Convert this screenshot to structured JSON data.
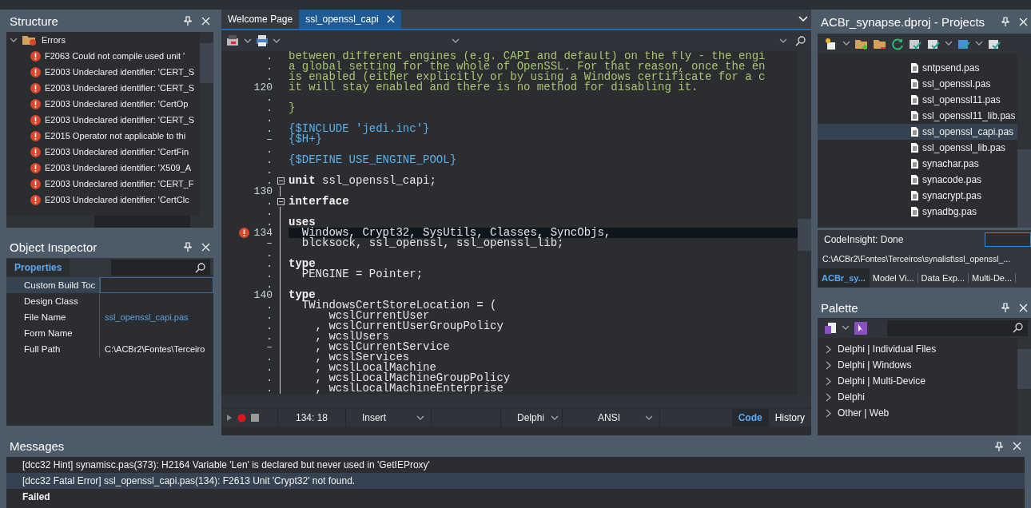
{
  "structure": {
    "title": "Structure",
    "root": {
      "label": "Errors",
      "expanded": true,
      "children": [
        {
          "label": "F2063 Could not compile used unit '"
        },
        {
          "label": "E2003 Undeclared identifier: 'CERT_S"
        },
        {
          "label": "E2003 Undeclared identifier: 'CERT_S"
        },
        {
          "label": "E2003 Undeclared identifier: 'CertOp"
        },
        {
          "label": "E2003 Undeclared identifier: 'CERT_S"
        },
        {
          "label": "E2015 Operator not applicable to thi"
        },
        {
          "label": "E2003 Undeclared identifier: 'CertFin"
        },
        {
          "label": "E2003 Undeclared identifier: 'X509_A"
        },
        {
          "label": "E2003 Undeclared identifier: 'CERT_F"
        },
        {
          "label": "E2003 Undeclared identifier: 'CertClc"
        }
      ]
    }
  },
  "object_inspector": {
    "title": "Object Inspector",
    "tab": "Properties",
    "properties": [
      {
        "name": "Custom Build Toc",
        "selected": true,
        "kind": "text"
      },
      {
        "name": "Design Class",
        "selected": false
      },
      {
        "name": "File Name",
        "value": "ssl_openssl_capi.pas",
        "selected": false,
        "kind": "link"
      },
      {
        "name": "Form Name",
        "selected": false
      },
      {
        "name": "Full Path",
        "value": "C:\\ACBr2\\Fontes\\Terceiro",
        "selected": false,
        "kind": "text"
      }
    ]
  },
  "editor": {
    "tabs": [
      {
        "label": "Welcome Page",
        "selected": false
      },
      {
        "label": "ssl_openssl_capi",
        "selected": true
      }
    ],
    "lines": [
      {
        "gutter": ".",
        "text": "between different engines (e.g. CAPI and default) on the fly - the engi",
        "kind": "comment",
        "error": false,
        "fold": false
      },
      {
        "gutter": ".",
        "text": "a global setting for the whole of OpenSSL. For that reason, once the en",
        "kind": "comment",
        "error": false,
        "fold": false
      },
      {
        "gutter": ".",
        "text": "is enabled (either explicitly or by using a Windows certificate for a c",
        "kind": "comment",
        "error": false,
        "fold": false
      },
      {
        "gutter": "120",
        "text": "it will stay enabled and there is no method for disabling it.",
        "kind": "comment",
        "error": false,
        "fold": false
      },
      {
        "gutter": ".",
        "error": false,
        "fold": false
      },
      {
        "gutter": ".",
        "text": "}",
        "kind": "comment",
        "error": false,
        "fold": false
      },
      {
        "gutter": ".",
        "error": false,
        "fold": false
      },
      {
        "gutter": ".",
        "text": "{$INCLUDE 'jedi.inc'}",
        "kind": "directive",
        "error": false,
        "fold": false
      },
      {
        "gutter": "–",
        "text": "{$H+}",
        "kind": "directive",
        "error": false,
        "fold": false
      },
      {
        "gutter": ".",
        "error": false,
        "fold": false
      },
      {
        "gutter": ".",
        "text": "{$DEFINE USE_ENGINE_POOL}",
        "kind": "directive",
        "error": false,
        "fold": false
      },
      {
        "gutter": ".",
        "error": false,
        "fold": false
      },
      {
        "gutter": ".",
        "text": "**unit** ssl_openssl_capi;",
        "kind": "code",
        "error": false,
        "fold": true
      },
      {
        "gutter": "130",
        "error": false,
        "fold": false
      },
      {
        "gutter": ".",
        "text": "interface",
        "kind": "keyword",
        "error": false,
        "fold": true
      },
      {
        "gutter": ".",
        "error": false,
        "fold": false
      },
      {
        "gutter": ".",
        "text": "uses",
        "kind": "keyword",
        "error": false,
        "fold": false
      },
      {
        "gutter": "134",
        "text": "  Windows, Crypt32, SysUtils, Classes, SyncObjs,",
        "kind": "code",
        "error": true,
        "fold": false
      },
      {
        "gutter": "–",
        "text": "  blcksock, ssl_openssl, ssl_openssl_lib;",
        "kind": "code",
        "error": false,
        "fold": false
      },
      {
        "gutter": ".",
        "error": false,
        "fold": false
      },
      {
        "gutter": ".",
        "text": "type",
        "kind": "keyword",
        "error": false,
        "fold": false
      },
      {
        "gutter": ".",
        "text": "  PENGINE = Pointer;",
        "kind": "code",
        "error": false,
        "fold": false
      },
      {
        "gutter": ".",
        "error": false,
        "fold": false
      },
      {
        "gutter": "140",
        "text": "type",
        "kind": "keyword",
        "error": false,
        "fold": false
      },
      {
        "gutter": ".",
        "text": "  TWindowsCertStoreLocation = (",
        "kind": "code",
        "error": false,
        "fold": false
      },
      {
        "gutter": ".",
        "text": "      wcslCurrentUser",
        "kind": "code",
        "error": false,
        "fold": false
      },
      {
        "gutter": ".",
        "text": "    , wcslCurrentUserGroupPolicy",
        "kind": "code",
        "error": false,
        "fold": false
      },
      {
        "gutter": ".",
        "text": "    , wcslUsers",
        "kind": "code",
        "error": false,
        "fold": false
      },
      {
        "gutter": "–",
        "text": "    , wcslCurrentService",
        "kind": "code",
        "error": false,
        "fold": false
      },
      {
        "gutter": ".",
        "text": "    , wcslServices",
        "kind": "code",
        "error": false,
        "fold": false
      },
      {
        "gutter": ".",
        "text": "    , wcslLocalMachine",
        "kind": "code",
        "error": false,
        "fold": false
      },
      {
        "gutter": ".",
        "text": "    , wcslLocalMachineGroupPolicy",
        "kind": "code",
        "error": false,
        "fold": false
      },
      {
        "gutter": ".",
        "text": "    , wcslLocalMachineEnterprise",
        "kind": "code",
        "error": false,
        "fold": false
      }
    ],
    "status": {
      "position": "134: 18",
      "mode": "Insert",
      "language": "Delphi",
      "encoding": "ANSI"
    },
    "view_tabs": [
      {
        "label": "Code",
        "selected": true
      },
      {
        "label": "History",
        "selected": false
      }
    ]
  },
  "projects": {
    "title": "ACBr_synapse.dproj - Projects",
    "files": [
      {
        "label": "sntpsend.pas",
        "selected": false
      },
      {
        "label": "ssl_openssl.pas",
        "selected": false
      },
      {
        "label": "ssl_openssl11.pas",
        "selected": false
      },
      {
        "label": "ssl_openssl11_lib.pas",
        "selected": false
      },
      {
        "label": "ssl_openssl_capi.pas",
        "selected": true
      },
      {
        "label": "ssl_openssl_lib.pas",
        "selected": false
      },
      {
        "label": "synachar.pas",
        "selected": false
      },
      {
        "label": "synacode.pas",
        "selected": false
      },
      {
        "label": "synacrypt.pas",
        "selected": false
      },
      {
        "label": "synadbg.pas",
        "selected": false
      }
    ],
    "status": "CodeInsight: Done",
    "path": "C:\\ACBr2\\Fontes\\Terceiros\\synalist\\ssl_openssl_...",
    "tabs": [
      {
        "label": "ACBr_sy...",
        "selected": true
      },
      {
        "label": "Model Vi...",
        "selected": false
      },
      {
        "label": "Data Exp...",
        "selected": false
      },
      {
        "label": "Multi-De...",
        "selected": false
      }
    ]
  },
  "palette": {
    "title": "Palette",
    "items": [
      {
        "label": "Delphi | Individual Files"
      },
      {
        "label": "Delphi | Windows"
      },
      {
        "label": "Delphi | Multi-Device"
      },
      {
        "label": "Delphi"
      },
      {
        "label": "Other | Web"
      }
    ]
  },
  "messages": {
    "title": "Messages",
    "rows": [
      {
        "text": "[dcc32 Hint] synamisc.pas(373): H2164 Variable 'Len' is declared but never used in 'GetIEProxy'",
        "kind": "hint",
        "selected": false
      },
      {
        "text": "[dcc32 Fatal Error] ssl_openssl_capi.pas(134): F2613 Unit 'Crypt32' not found.",
        "kind": "error",
        "selected": true
      },
      {
        "text": "Failed",
        "kind": "result",
        "selected": false
      }
    ]
  }
}
